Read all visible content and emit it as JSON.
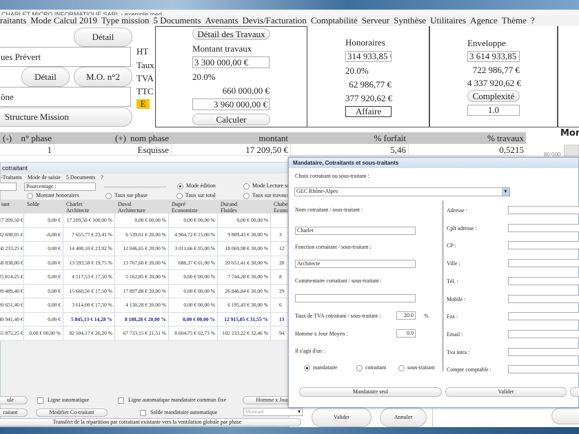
{
  "window": {
    "title": "CHARLET MICRO INFORMATIQUE SARL - exemple.med"
  },
  "menu": [
    "raitants",
    "Mode Calcul 2019",
    "Type mission",
    "5 Documents",
    "Avenants",
    "Devis/Facturation",
    "Comptabilité",
    "Serveur",
    "Synthèse",
    "Utilitaires",
    "Agence",
    "Thème",
    "?"
  ],
  "top": {
    "detail1": "Détail",
    "client": "ues Prévert",
    "detail2": "Détail",
    "mo2": "M.O. n°2",
    "location": "ône",
    "structure": "Structure Mission",
    "labels": {
      "ht": "HT",
      "taux": "Taux",
      "tva": "TVA",
      "ttc": "TTC",
      "e": "E"
    },
    "travaux": {
      "button": "Détail des Travaux",
      "title": "Montant travaux",
      "ht": "3 300 000,00 €",
      "taux": "20.0%",
      "tva": "660 000,00 €",
      "ttc": "3 960 000,00 €",
      "calc": "Calculer"
    },
    "honoraires": {
      "title": "Honoraires",
      "ht": "314 933,85 €",
      "taux": "20.0%",
      "tva": "62 986,77 €",
      "ttc": "377 920,62 €",
      "button": "Affaire"
    },
    "enveloppe": {
      "title": "Enveloppe",
      "ht": "3 614 933,85 €",
      "tva": "722 986,77 €",
      "ttc": "4 337 920,62 €",
      "button": "Complexité",
      "complexite": "1.0"
    },
    "chart": {
      "title": "Mon",
      "tick": "80 000"
    }
  },
  "phases": {
    "headers": [
      "(-)",
      "n° phase",
      "(+)",
      "nom phase",
      "montant",
      "% forfait",
      "% travaux"
    ],
    "rows": [
      {
        "n": "1",
        "nom": "Esquisse",
        "montant": "17 209,50 €",
        "forfait": "5,46",
        "travaux": "0,5215"
      }
    ]
  },
  "cotraitant": {
    "title": "cotraitant",
    "menu": [
      "-Traitants",
      "Mode de saisie",
      "5 Documents",
      "?"
    ],
    "pourcentage": "Pourcentage :",
    "radios": {
      "mode_edition": "Mode édition",
      "mode_lecture": "Mode Lecture seu",
      "montant_hon": "Montant honoraires",
      "taux_phase": "Taux sur phase",
      "taux_total": "Taux sur total",
      "taux_travaux": "Taux sur travaux"
    },
    "columns": [
      [
        "tant",
        ""
      ],
      [
        "Solde",
        ""
      ],
      [
        "Charlet",
        "Architecte"
      ],
      [
        "Duval",
        "Architecture"
      ],
      [
        "Dupré",
        "Economiste"
      ],
      [
        "Durand",
        "Fluides"
      ],
      [
        "Chabert",
        "Econom"
      ]
    ],
    "rows": [
      [
        "17 209,50 €",
        "0,00 €",
        "17 209,50 € 100,00 %",
        "0,00 € 00,00 %",
        "0,00 € 00,00 %",
        "0,00 € 00,00 %",
        ""
      ],
      [
        "32 698,05 €",
        "-0,00 €",
        "7 655,77 € 23,41 %",
        "6 539,61 € 20,00 %",
        "4 904,72 € 15,00 %",
        "9 809,43 € 30,00 %",
        "3"
      ],
      [
        "60 233,25 €",
        "0,00 €",
        "14 408,10 € 23,92 %",
        "12 046,65 € 20,00 %",
        "3 011,66 € 05,00 %",
        "18 069,98 € 30,00 %",
        "12"
      ],
      [
        "68 838,00 €",
        "0,00 €",
        "13 593,58 € 19,75 %",
        "13 767,60 € 20,00 %",
        "688,37 € 01,00 %",
        "20 651,41 € 30,00 %",
        "20"
      ],
      [
        "25 814,25 €",
        "0,00 €",
        "4 517,53 € 17,50 %",
        "5 162,85 € 20,00 %",
        "0,00 € 00,00 %",
        "7 744,28 € 30,00 %",
        "8"
      ],
      [
        "89 489,40 €",
        "0,00 €",
        "15 660,56 € 17,50 %",
        "17 897,88 € 20,00 %",
        "0,00 € 00,00 %",
        "26 846,84 € 30,00 %",
        "29"
      ],
      [
        "20 651,40 €",
        "0,00 €",
        "3 614,00 € 17,50 %",
        "4 130,28 € 20,00 %",
        "0,00 € 00,00 %",
        "6 195,43 € 30,00 %",
        "6"
      ],
      [
        "40 941,40 €",
        "0,00 €",
        "5 845,13 € 14,28 %",
        "8 188,28 € 20,00 %",
        "0,00 € 00,00 %",
        "12 915,85 € 31,55 %",
        "13"
      ],
      [
        "55 875,25 €",
        "0,00 € 00,00 %",
        "82 504,17 € 26,20 %",
        "67 733,15 € 21,51 %",
        "8 604,75 € 02,73 %",
        "102 233,22 € 32,46 %",
        "94"
      ]
    ],
    "bottom": {
      "btn1": "ule",
      "ligne_auto": "Ligne automatique",
      "ligne_auto_mand": "Ligne automatique mandataire commun fixe",
      "homme_jour": "Homme x Jour",
      "btn2": "raitant",
      "modifier": "Modifier Co-traitant",
      "solde_auto": "Solde mandataire automatique",
      "montant_select": "Montant",
      "transfert": "Transfert de la répartition par cotraitant existante vers la ventilation globale par phase",
      "valider": "Valider",
      "annuler": "Annuler"
    }
  },
  "dialog": {
    "title": "Mandataire, Cotraitants et sous-traitants",
    "choix_label": "Choix cotraitant ou sous-traitant :",
    "choix_value": "GEC Rhône-Alpes",
    "nom_label": "Nom cotraitant / sous-traitant :",
    "nom": "Charlet",
    "fonction_label": "Fonction cotraitant / sous-traitant :",
    "fonction": "Architecte",
    "commentaire_label": "Commentaire cotraitant / sous-traitant :",
    "commentaire": "",
    "tva_label": "Taux de TVA cotraitant / sous-traitant :",
    "tva": "20.0",
    "pct": "%",
    "hj_label": "Homme x Jour Moyen :",
    "hj": "0.0",
    "type_label": "Il s'agit d'un :",
    "types": [
      "mandataire",
      "cotraitant",
      "sous-traitant"
    ],
    "selected_type": "mandataire",
    "right_fields": [
      "Adresse :",
      "Cplt adresse :",
      "CP :",
      "Ville :",
      "Tél. :",
      "Mobile :",
      "Fax :",
      "Email :",
      "Tva intra :",
      "Compte comptable :"
    ],
    "btn_mandataire": "Mandataire seul",
    "btn_valider": "Valider"
  }
}
